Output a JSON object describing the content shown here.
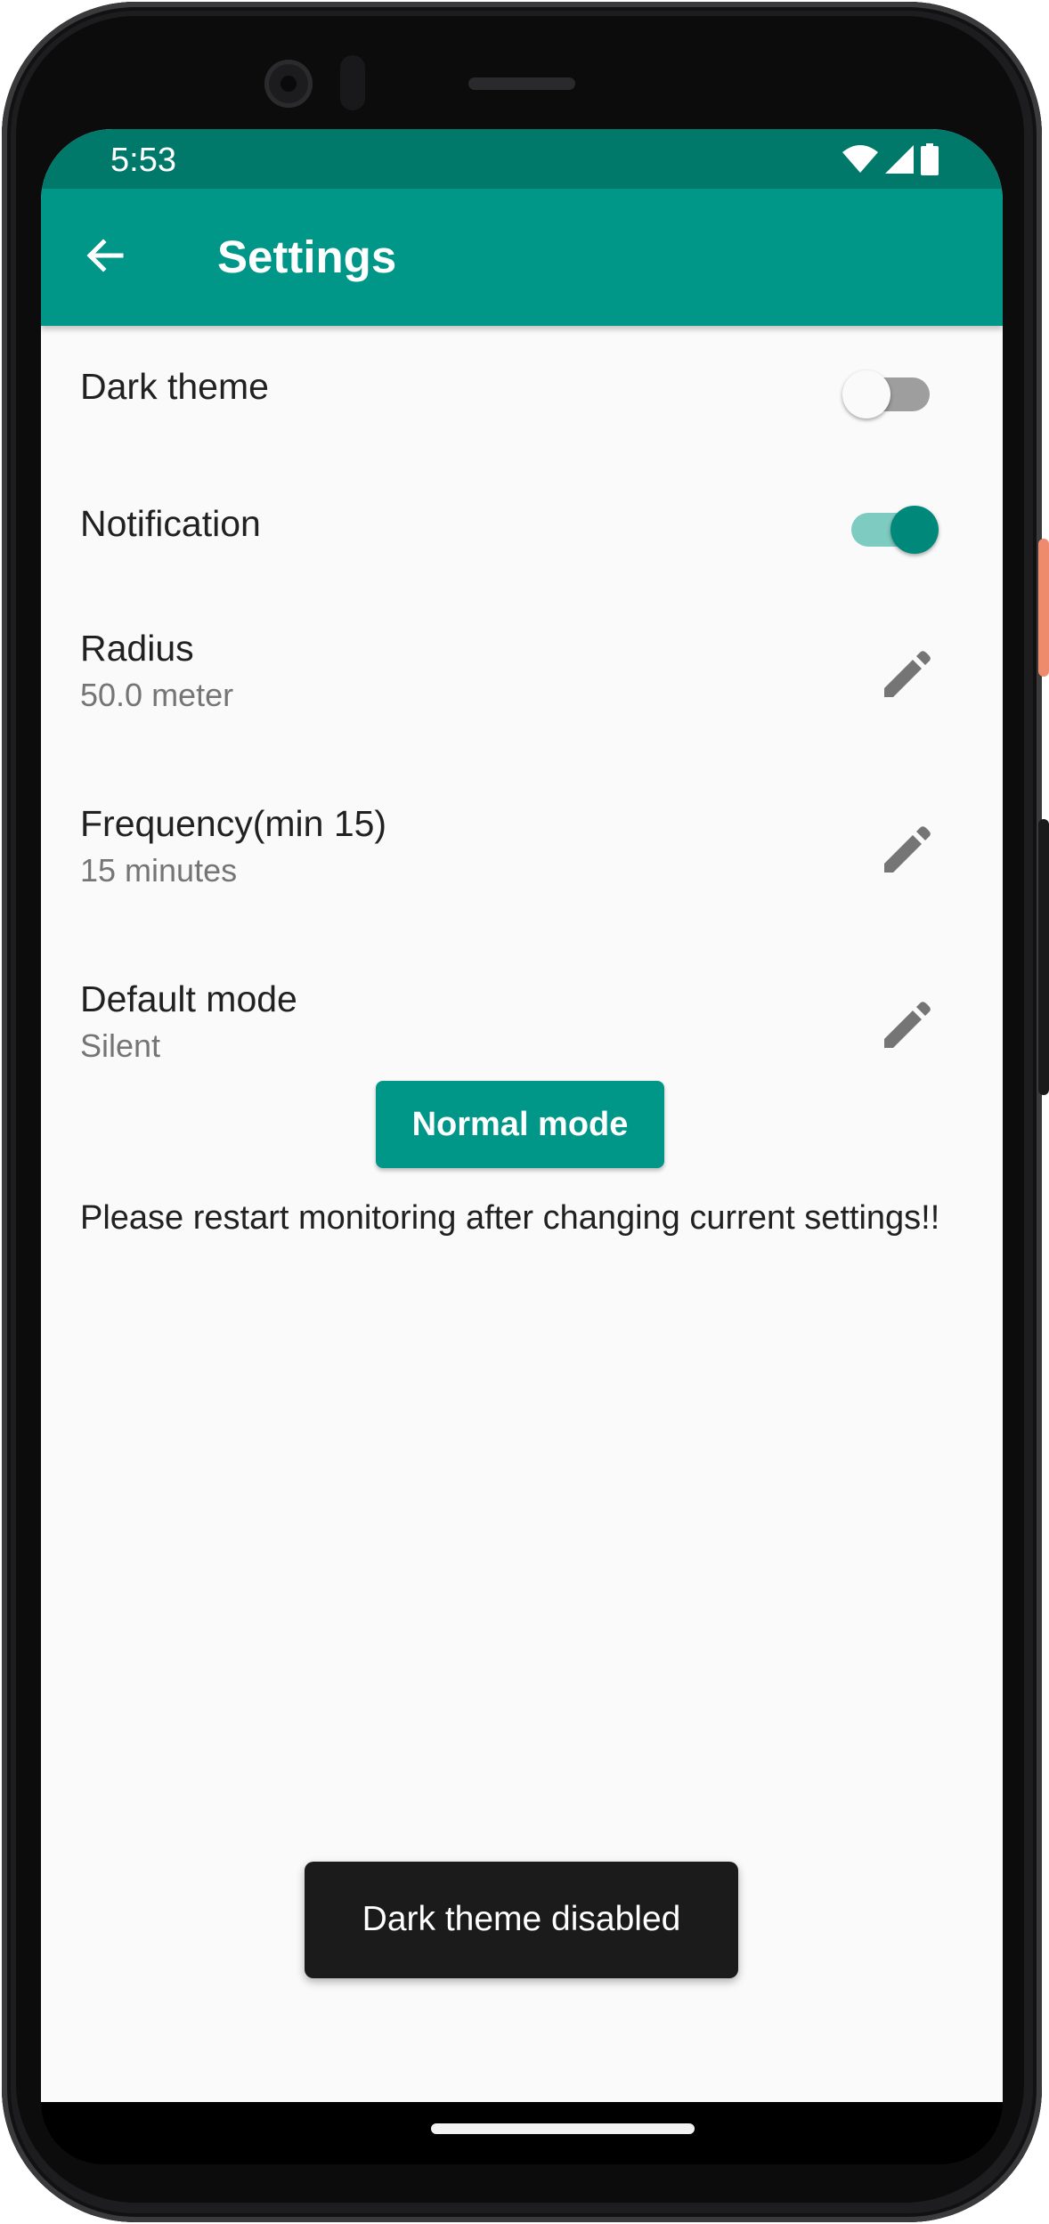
{
  "status_bar": {
    "time": "5:53",
    "icons": [
      "wifi-icon",
      "signal-icon",
      "battery-icon"
    ]
  },
  "app_bar": {
    "back_icon": "arrow-back-icon",
    "title": "Settings"
  },
  "settings": {
    "dark_theme": {
      "label": "Dark theme",
      "enabled": false
    },
    "notification": {
      "label": "Notification",
      "enabled": true
    },
    "radius": {
      "label": "Radius",
      "value": "50.0 meter",
      "action_icon": "pencil-edit-icon"
    },
    "frequency": {
      "label": "Frequency(min 15)",
      "value": "15 minutes",
      "action_icon": "pencil-edit-icon"
    },
    "default_mode": {
      "label": "Default mode",
      "value": "Silent",
      "action_icon": "pencil-edit-icon"
    }
  },
  "mode_button": {
    "label": "Normal mode"
  },
  "notice": {
    "text": "Please restart monitoring after changing current settings!!"
  },
  "snackbar": {
    "text": "Dark theme disabled"
  },
  "colors": {
    "status_bar": "#00796b",
    "app_bar": "#009688",
    "background": "#fafafa",
    "primary_text": "#212121",
    "secondary_text": "#757575",
    "snackbar": "#1b1b1b",
    "power_button": "#ee8b6d"
  }
}
